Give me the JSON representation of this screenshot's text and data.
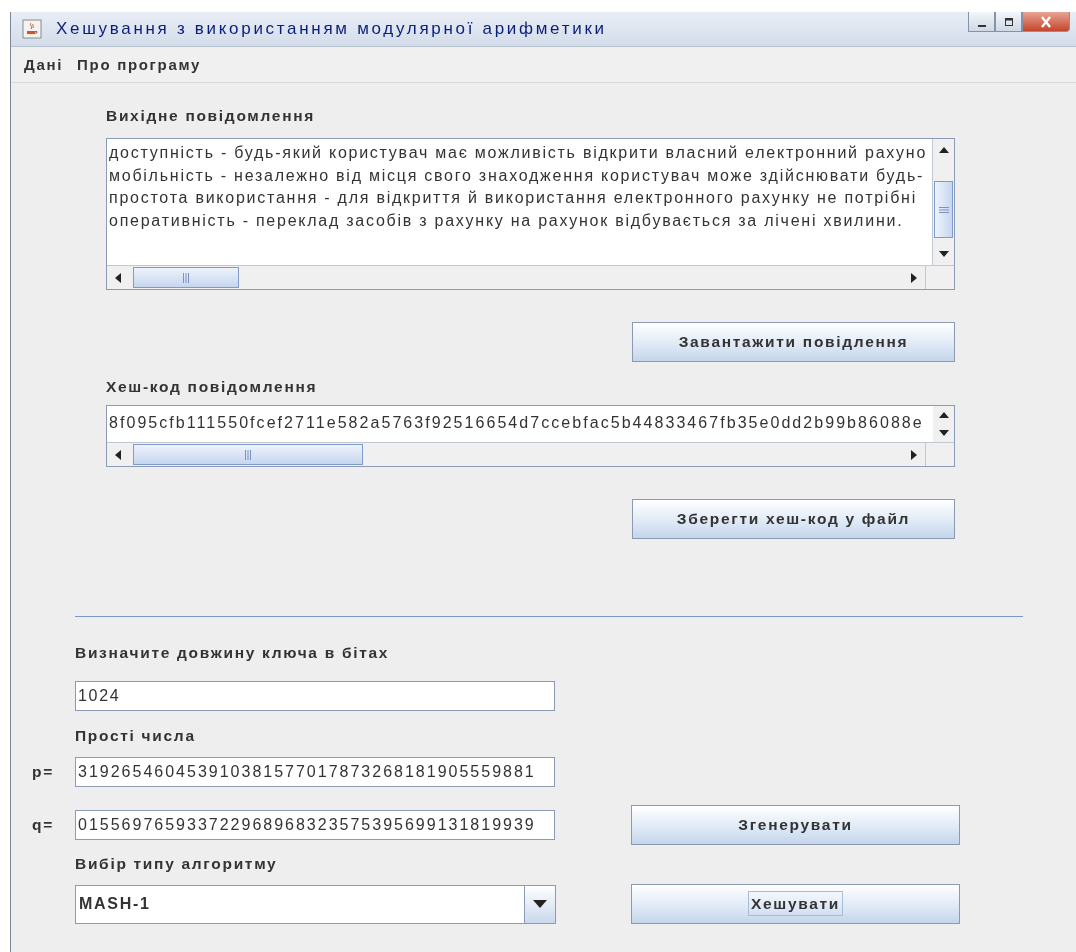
{
  "window": {
    "title": "Хешування з використанням модулярної арифметики"
  },
  "menu": [
    {
      "label": "Дані"
    },
    {
      "label": "Про програму"
    }
  ],
  "source": {
    "label": "Вихідне повідомлення",
    "lines": [
      "доступність - будь-який користувач має можливість відкрити власний електронний рахуно",
      "мобільність - незалежно від місця свого знаходження користувач може здійснювати будь-",
      "простота використання - для відкриття й використання електронного рахунку не потрібні",
      "оперативність - переклад засобів з рахунку на рахунок відбувається за лічені хвилини."
    ],
    "button": "Завантажити повідлення"
  },
  "hash": {
    "label": "Хеш-код повідомлення",
    "value": "8f095cfb111550fcef2711e582a5763f92516654d7ccebfac5b44833467fb35e0dd2b99b86088e",
    "button": "Зберегти хеш-код у файл"
  },
  "key_length": {
    "label": "Визначите довжину ключа в бітах",
    "value": "1024"
  },
  "primes": {
    "label": "Прості числа",
    "p_label": "p=",
    "p_value": "319265460453910381577017873268181905559881",
    "q_label": "q=",
    "q_value": "015569765933722968968323575395699131819939",
    "button": "Згенерувати"
  },
  "algorithm": {
    "label": "Вибір типу алгоритму",
    "value": "MASH-1",
    "button": "Хешувати",
    "button_focused": true
  }
}
